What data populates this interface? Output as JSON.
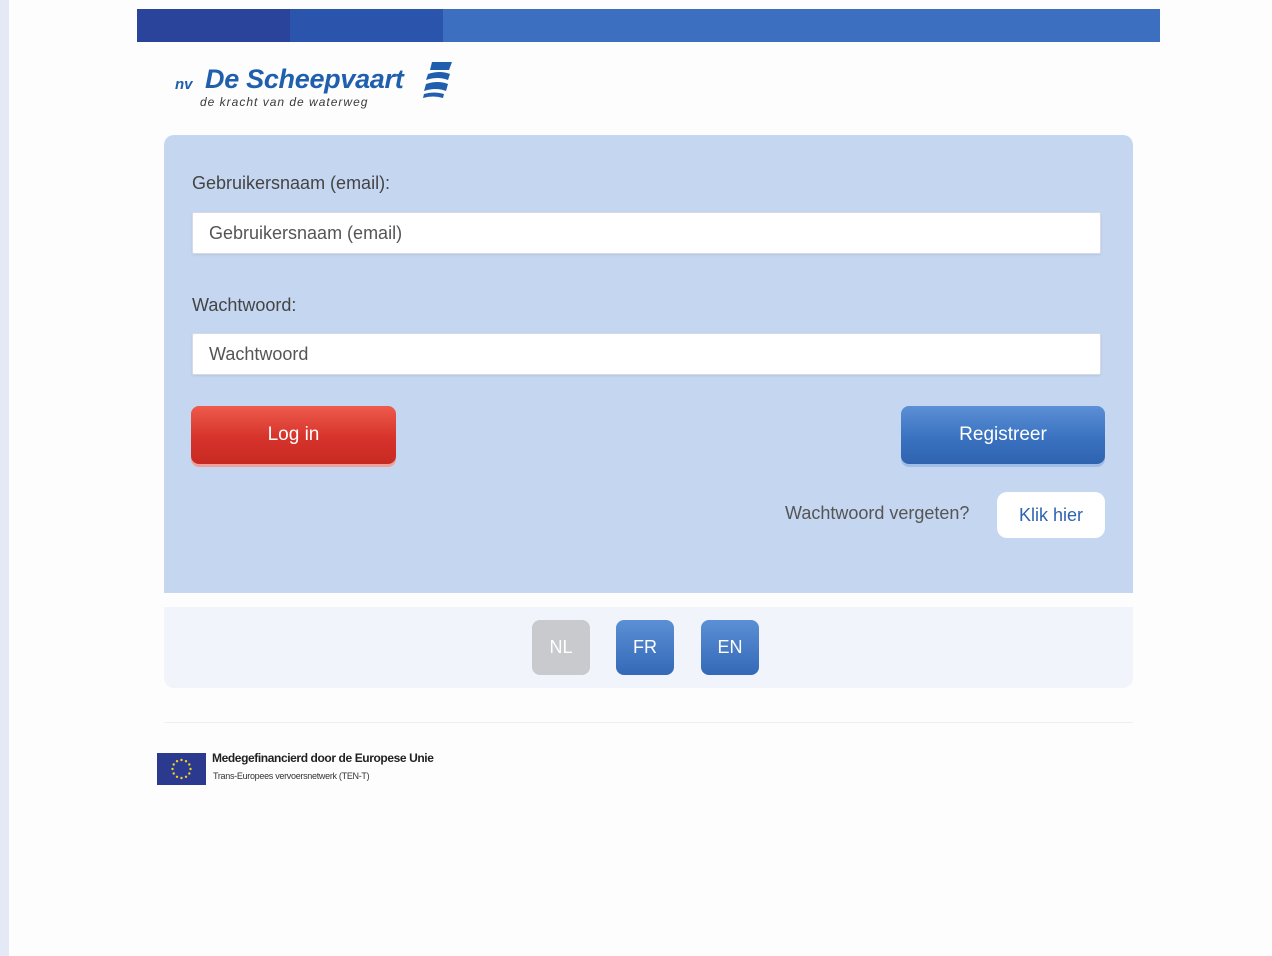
{
  "header": {
    "logo": {
      "prefix": "nv",
      "name": "De Scheepvaart",
      "tagline": "de kracht van de waterweg"
    }
  },
  "login_form": {
    "username_label": "Gebruikersnaam (email):",
    "username_placeholder": "Gebruikersnaam (email)",
    "username_value": "",
    "password_label": "Wachtwoord:",
    "password_placeholder": "Wachtwoord",
    "password_value": "",
    "login_button": "Log in",
    "register_button": "Registreer",
    "forgot_text": "Wachtwoord vergeten?",
    "forgot_link": "Klik hier"
  },
  "language_selector": {
    "options": [
      "NL",
      "FR",
      "EN"
    ],
    "selected": "NL"
  },
  "footer": {
    "eu_line1": "Medegefinancierd door de Europese Unie",
    "eu_line2": "Trans-Europees vervoersnetwerk (TEN-T)"
  },
  "colors": {
    "brand_blue": "#1f5fae",
    "panel": "#c5d6f1",
    "login_red": "#d6332b",
    "register_blue": "#3a72c0",
    "lang_inactive": "#c9cacd"
  }
}
